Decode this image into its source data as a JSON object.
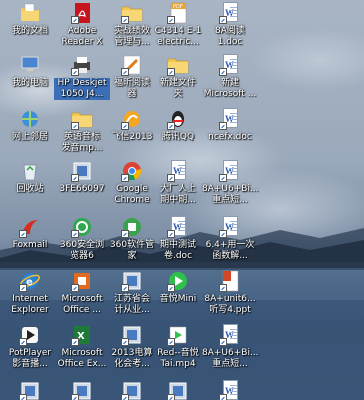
{
  "desktop": {
    "icons": [
      {
        "label": "我的文档",
        "icon": "my-documents-icon",
        "selected": false
      },
      {
        "label": "Adobe\nReader X",
        "icon": "adobe-reader-icon",
        "selected": false
      },
      {
        "label": "实战绩效\n管理与...",
        "icon": "folder-icon",
        "selected": false
      },
      {
        "label": "C4314 E-1\nelectric...",
        "icon": "pdf-icon",
        "selected": false
      },
      {
        "label": "8A阅读\n1.doc",
        "icon": "word-doc-icon",
        "selected": false
      },
      {
        "label": "我的电脑",
        "icon": "my-computer-icon",
        "selected": false
      },
      {
        "label": "HP Deskjet\n1050 J4...",
        "icon": "printer-icon",
        "selected": true
      },
      {
        "label": "福昕阅读\n器",
        "icon": "foxit-reader-icon",
        "selected": false
      },
      {
        "label": "新建文件\n夹",
        "icon": "folder-icon",
        "selected": false
      },
      {
        "label": "新建\nMicrosoft ...",
        "icon": "word-doc-icon",
        "selected": false
      },
      {
        "label": "网上邻居",
        "icon": "network-icon",
        "selected": false
      },
      {
        "label": "英语音标\n发音mp...",
        "icon": "folder-icon",
        "selected": false
      },
      {
        "label": "飞信2013",
        "icon": "fetion-icon",
        "selected": false
      },
      {
        "label": "腾讯QQ",
        "icon": "qq-icon",
        "selected": false
      },
      {
        "label": "ncefx.doc",
        "icon": "word-doc-icon",
        "selected": false
      },
      {
        "label": "回收站",
        "icon": "recycle-bin-icon",
        "selected": false
      },
      {
        "label": "3FE66097",
        "icon": "app-icon",
        "selected": false
      },
      {
        "label": "Google\nChrome",
        "icon": "chrome-icon",
        "selected": false
      },
      {
        "label": "大厂人上\n期中期...",
        "icon": "word-doc-icon",
        "selected": false
      },
      {
        "label": "8A+U6+Bi...\n重点短...",
        "icon": "word-doc-icon",
        "selected": false
      },
      {
        "label": "Foxmail",
        "icon": "foxmail-icon",
        "selected": false
      },
      {
        "label": "360安全浏\n览器6",
        "icon": "360-browser-icon",
        "selected": false
      },
      {
        "label": "360软件管\n家",
        "icon": "360-software-icon",
        "selected": false
      },
      {
        "label": "期中测试\n卷.doc",
        "icon": "word-doc-icon",
        "selected": false
      },
      {
        "label": "6.4+用一次\n函数解...",
        "icon": "word-doc-icon",
        "selected": false
      },
      {
        "label": "Internet\nExplorer",
        "icon": "ie-icon",
        "selected": false
      },
      {
        "label": "Microsoft\nOffice ...",
        "icon": "office-icon",
        "selected": false
      },
      {
        "label": "江苏省会\n计从业...",
        "icon": "app-icon",
        "selected": false
      },
      {
        "label": "音悦Mini",
        "icon": "yinyue-icon",
        "selected": false
      },
      {
        "label": "8A+unit6...\n听写4.ppt",
        "icon": "ppt-icon",
        "selected": false
      },
      {
        "label": "PotPlayer\n影音播...",
        "icon": "potplayer-icon",
        "selected": false
      },
      {
        "label": "Microsoft\nOffice Ex...",
        "icon": "excel-icon",
        "selected": false
      },
      {
        "label": "2013电算\n化会考...",
        "icon": "app-icon",
        "selected": false
      },
      {
        "label": "Red--音悦\nTai.mp4",
        "icon": "video-icon",
        "selected": false
      },
      {
        "label": "8A+U6+Bi...\n重点短...",
        "icon": "word-doc-icon",
        "selected": false
      },
      {
        "label": "",
        "icon": "app-icon",
        "selected": false
      },
      {
        "label": "",
        "icon": "app-icon",
        "selected": false
      },
      {
        "label": "",
        "icon": "app-icon",
        "selected": false
      },
      {
        "label": "",
        "icon": "app-icon",
        "selected": false
      },
      {
        "label": "",
        "icon": "word-doc-icon",
        "selected": false
      }
    ]
  },
  "colors": {
    "selection": "#3a6fb8",
    "folder": "#f2c94c",
    "word": "#2b58b3",
    "adobe": "#c8141c",
    "excel": "#1f7a3a",
    "ppt": "#d24726",
    "qq": "#222222",
    "chrome_red": "#db4437",
    "chrome_green": "#0f9d58",
    "chrome_yellow": "#f4b400",
    "chrome_blue": "#4285f4"
  }
}
